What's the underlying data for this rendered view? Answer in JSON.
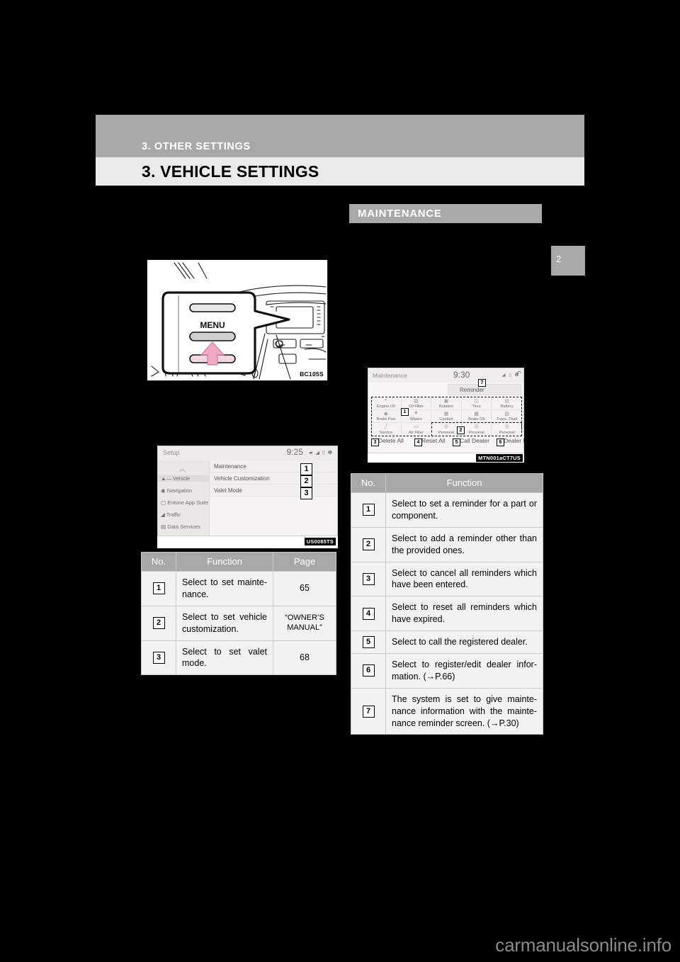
{
  "header": {
    "chapter": "3. OTHER SETTINGS",
    "title": "3. VEHICLE SETTINGS",
    "page_tab": "2"
  },
  "right_section": {
    "heading": "MAINTENANCE"
  },
  "figures": {
    "dashboard": {
      "code": "BC105S",
      "button_label": "MENU"
    },
    "setup_screen": {
      "code": "US0085TS",
      "title": "Setup",
      "clock": "9:25",
      "status_icons": "status-bar-icons",
      "sidebar": [
        {
          "label": "Vehicle",
          "icon": "car-icon",
          "selected": true
        },
        {
          "label": "Navigation",
          "icon": "compass-icon",
          "selected": false
        },
        {
          "label": "Entune App Suite",
          "icon": "app-icon",
          "selected": false
        },
        {
          "label": "Traffic",
          "icon": "traffic-icon",
          "selected": false
        },
        {
          "label": "Data Services",
          "icon": "data-icon",
          "selected": false
        }
      ],
      "rows": [
        {
          "label": "Maintenance",
          "badge": "1"
        },
        {
          "label": "Vehicle Customization",
          "badge": "2"
        },
        {
          "label": "Valet Mode",
          "badge": "3"
        }
      ]
    },
    "maintenance_screen": {
      "code": "MTN001aCT7US",
      "title": "Maintenance",
      "clock": "9:30",
      "reminder_label": "Reminder",
      "back_icon": "back-arrow-icon",
      "grid": [
        {
          "label": "Engine Oil",
          "icon": "engine-oil-icon"
        },
        {
          "label": "Oil Filter",
          "icon": "oil-filter-icon"
        },
        {
          "label": "Rotation",
          "icon": "tire-rotation-icon"
        },
        {
          "label": "Tires",
          "icon": "tire-icon"
        },
        {
          "label": "Battery",
          "icon": "battery-icon"
        },
        {
          "label": "Brake Pad",
          "icon": "brake-pad-icon"
        },
        {
          "label": "Wipers",
          "icon": "wiper-icon"
        },
        {
          "label": "Coolant",
          "icon": "coolant-icon"
        },
        {
          "label": "Brake Oil",
          "icon": "brake-oil-icon"
        },
        {
          "label": "Trans. Fluid",
          "icon": "trans-fluid-icon"
        },
        {
          "label": "Service",
          "icon": "service-icon"
        },
        {
          "label": "Air Filter",
          "icon": "air-filter-icon"
        },
        {
          "label": "Personal",
          "icon": "personal-icon"
        },
        {
          "label": "Personal",
          "icon": "personal-icon"
        },
        {
          "label": "Personal",
          "icon": "personal-icon"
        }
      ],
      "bottom_buttons": [
        {
          "badge": "3",
          "label": "Delete All"
        },
        {
          "badge": "4",
          "label": "Reset All"
        },
        {
          "badge": "5",
          "label": "Call Dealer"
        },
        {
          "badge": "6",
          "label": "Dealer Info"
        }
      ],
      "callout_badges": [
        "1",
        "2",
        "7"
      ]
    }
  },
  "left_table": {
    "headers": {
      "no": "No.",
      "function": "Function",
      "page": "Page"
    },
    "rows": [
      {
        "no": "1",
        "function": "Select to set mainte-nance.",
        "page": "65",
        "page_small": false
      },
      {
        "no": "2",
        "function": "Select to set vehicle customization.",
        "page": "“OWNER’S MANUAL”",
        "page_small": true
      },
      {
        "no": "3",
        "function": "Select to set valet mode.",
        "page": "68",
        "page_small": false
      }
    ]
  },
  "right_table": {
    "headers": {
      "no": "No.",
      "function": "Function"
    },
    "rows": [
      {
        "no": "1",
        "function": "Select to set a reminder for a part or component."
      },
      {
        "no": "2",
        "function": "Select to add a reminder other than the provided ones."
      },
      {
        "no": "3",
        "function": "Select to cancel all reminders which have been entered."
      },
      {
        "no": "4",
        "function": "Select to reset all reminders which have expired."
      },
      {
        "no": "5",
        "function": "Select to call the registered dealer."
      },
      {
        "no": "6",
        "function": "Select to register/edit dealer infor-mation. (→P.66)"
      },
      {
        "no": "7",
        "function": "The system is set to give mainte-nance information with the mainte-nance reminder screen. (→P.30)"
      }
    ]
  },
  "watermark": "carmanualsonline.info",
  "colors": {
    "band_gray": "#a8a8a8",
    "band_light": "#eaeaea",
    "table_cell": "#f2f2f2",
    "arrow_pink": "#efa9c4"
  }
}
